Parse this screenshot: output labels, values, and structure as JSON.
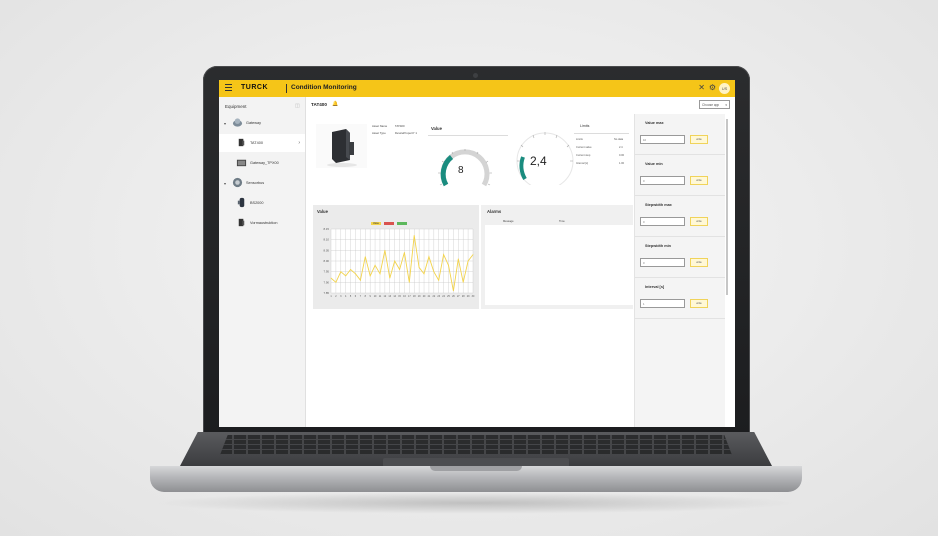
{
  "colors": {
    "accent_yellow": "#f5c518",
    "gauge_teal": "#1a8c7f",
    "line_yellow": "#f2d34b",
    "legend_red": "#d9534f",
    "legend_green": "#5cb85c"
  },
  "header": {
    "menu_icon": "hamburger-icon",
    "brand": "TURCK",
    "title": "Condition Monitoring",
    "icons": [
      "tools-icon",
      "gear-icon"
    ],
    "avatar": "US"
  },
  "sidebar": {
    "heading": "Equipment",
    "items": [
      {
        "label": "Gateway",
        "level": 0,
        "expandable": true
      },
      {
        "label": "TAT400",
        "level": 1,
        "active": true
      },
      {
        "label": "Gateway_TPX00",
        "level": 1
      },
      {
        "label": "Sensorbus",
        "level": 0,
        "expandable": true
      },
      {
        "label": "BS2000",
        "level": 1
      },
      {
        "label": "Vormaustruktion",
        "level": 1
      }
    ]
  },
  "main": {
    "device_title": "TAT400",
    "choose_app": "Choose app",
    "device_info": {
      "asset_name_label": "Asset Name",
      "asset_name_value": "TAT400",
      "asset_type_label": "Asset Type",
      "asset_type_value": "DevicePropertY 1"
    },
    "value_panel_title": "Value",
    "gauge1_value": "8",
    "gauge2_value": "2,4",
    "limits": {
      "heading": "Limits",
      "rows": [
        {
          "label": "Limits",
          "value": "No data"
        },
        {
          "label": "Current value",
          "value": "2.4"
        },
        {
          "label": "Current step",
          "value": "0.00"
        },
        {
          "label": "Interval [s]",
          "value": "1.00"
        }
      ]
    }
  },
  "right_panel": {
    "sections": [
      {
        "title": "Value max",
        "input": "10",
        "button": "write"
      },
      {
        "title": "Value min",
        "input": "0",
        "button": "write"
      },
      {
        "title": "Stepwidth max",
        "input": "0",
        "button": "write"
      },
      {
        "title": "Stepwidth min",
        "input": "0",
        "button": "write"
      },
      {
        "title": "Interval [s]",
        "input": "1",
        "button": "write"
      }
    ]
  },
  "alarms": {
    "title": "Alarms",
    "columns": [
      "Message",
      "Time"
    ]
  },
  "chart_data": {
    "type": "line",
    "title": "Value",
    "legend": [
      "Value",
      "",
      ""
    ],
    "y_ticks": [
      "8.15",
      "8.10",
      "8.05",
      "8.00",
      "7.95",
      "7.90",
      "7.85"
    ],
    "ylim": [
      7.85,
      8.15
    ],
    "x": [
      "1",
      "2",
      "3",
      "4",
      "5",
      "6",
      "7",
      "8",
      "9",
      "10",
      "11",
      "12",
      "13",
      "14",
      "15",
      "16",
      "17",
      "18",
      "19",
      "20",
      "21",
      "22",
      "23",
      "24",
      "25",
      "26",
      "27",
      "28",
      "29",
      "30"
    ],
    "series": [
      {
        "name": "Value",
        "values": [
          7.92,
          7.9,
          7.95,
          7.93,
          7.96,
          7.94,
          7.91,
          8.02,
          7.93,
          7.98,
          7.94,
          8.05,
          7.92,
          8.0,
          7.96,
          8.04,
          7.9,
          8.12,
          7.97,
          7.94,
          8.02,
          7.95,
          7.91,
          8.03,
          7.98,
          7.86,
          8.01,
          7.9,
          8.0,
          8.03
        ]
      }
    ]
  }
}
